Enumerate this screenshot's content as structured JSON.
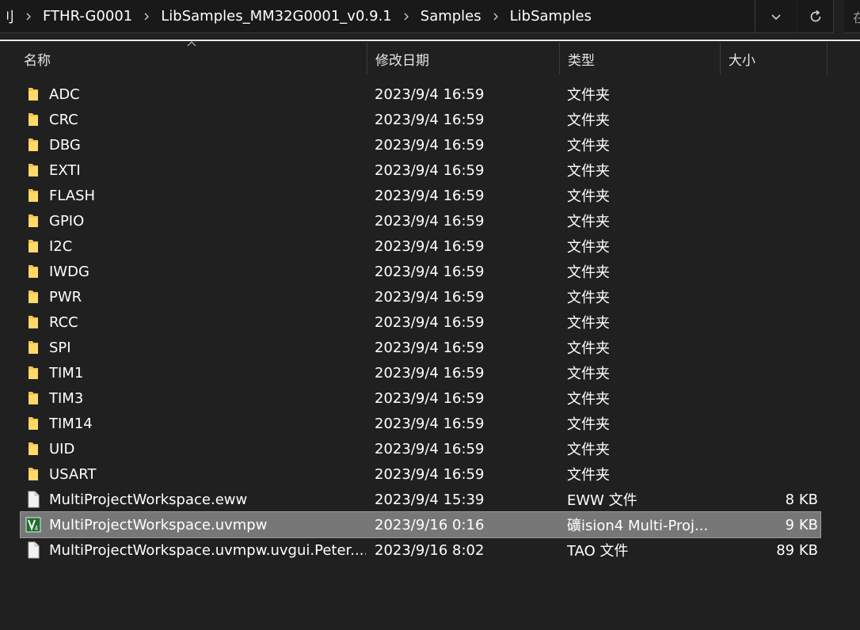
{
  "breadcrumb": {
    "items": [
      "刂",
      "FTHR-G0001",
      "LibSamples_MM32G0001_v0.9.1",
      "Samples",
      "LibSamples"
    ]
  },
  "search": {
    "placeholder": "在"
  },
  "columns": {
    "name": "名称",
    "date": "修改日期",
    "type": "类型",
    "size": "大小"
  },
  "files": [
    {
      "name": "ADC",
      "date": "2023/9/4 16:59",
      "type": "文件夹",
      "size": "",
      "icon": "folder-icon"
    },
    {
      "name": "CRC",
      "date": "2023/9/4 16:59",
      "type": "文件夹",
      "size": "",
      "icon": "folder-icon"
    },
    {
      "name": "DBG",
      "date": "2023/9/4 16:59",
      "type": "文件夹",
      "size": "",
      "icon": "folder-icon"
    },
    {
      "name": "EXTI",
      "date": "2023/9/4 16:59",
      "type": "文件夹",
      "size": "",
      "icon": "folder-icon"
    },
    {
      "name": "FLASH",
      "date": "2023/9/4 16:59",
      "type": "文件夹",
      "size": "",
      "icon": "folder-icon"
    },
    {
      "name": "GPIO",
      "date": "2023/9/4 16:59",
      "type": "文件夹",
      "size": "",
      "icon": "folder-icon"
    },
    {
      "name": "I2C",
      "date": "2023/9/4 16:59",
      "type": "文件夹",
      "size": "",
      "icon": "folder-icon"
    },
    {
      "name": "IWDG",
      "date": "2023/9/4 16:59",
      "type": "文件夹",
      "size": "",
      "icon": "folder-icon"
    },
    {
      "name": "PWR",
      "date": "2023/9/4 16:59",
      "type": "文件夹",
      "size": "",
      "icon": "folder-icon"
    },
    {
      "name": "RCC",
      "date": "2023/9/4 16:59",
      "type": "文件夹",
      "size": "",
      "icon": "folder-icon"
    },
    {
      "name": "SPI",
      "date": "2023/9/4 16:59",
      "type": "文件夹",
      "size": "",
      "icon": "folder-icon"
    },
    {
      "name": "TIM1",
      "date": "2023/9/4 16:59",
      "type": "文件夹",
      "size": "",
      "icon": "folder-icon"
    },
    {
      "name": "TIM3",
      "date": "2023/9/4 16:59",
      "type": "文件夹",
      "size": "",
      "icon": "folder-icon"
    },
    {
      "name": "TIM14",
      "date": "2023/9/4 16:59",
      "type": "文件夹",
      "size": "",
      "icon": "folder-icon"
    },
    {
      "name": "UID",
      "date": "2023/9/4 16:59",
      "type": "文件夹",
      "size": "",
      "icon": "folder-icon"
    },
    {
      "name": "USART",
      "date": "2023/9/4 16:59",
      "type": "文件夹",
      "size": "",
      "icon": "folder-icon"
    },
    {
      "name": "MultiProjectWorkspace.eww",
      "date": "2023/9/4 15:39",
      "type": "EWW 文件",
      "size": "8 KB",
      "icon": "document-icon"
    },
    {
      "name": "MultiProjectWorkspace.uvmpw",
      "date": "2023/9/16 0:16",
      "type": "礦ision4 Multi-Proj...",
      "size": "9 KB",
      "icon": "uvision-icon",
      "selected": true
    },
    {
      "name": "MultiProjectWorkspace.uvmpw.uvgui.Peter....",
      "date": "2023/9/16 8:02",
      "type": "TAO 文件",
      "size": "89 KB",
      "icon": "document-icon"
    }
  ],
  "colors": {
    "background": "#202020",
    "selection": "#777777",
    "folder": "#f4c54f"
  }
}
